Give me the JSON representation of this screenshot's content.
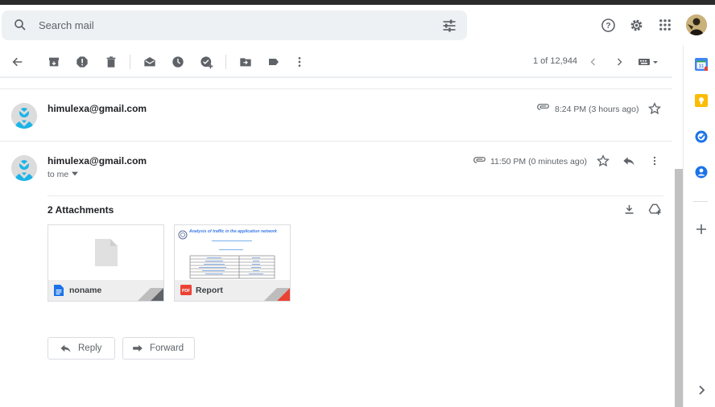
{
  "search": {
    "placeholder": "Search mail"
  },
  "toolbar": {
    "pager_text": "1 of 12,944"
  },
  "messages": [
    {
      "sender": "himulexa@gmail.com",
      "time": "8:24 PM (3 hours ago)"
    },
    {
      "sender": "himulexa@gmail.com",
      "time": "11:50 PM (0 minutes ago)",
      "recipient": "to me"
    }
  ],
  "attachments": {
    "title": "2 Attachments",
    "items": [
      {
        "name": "noname",
        "type_icon": "doc-icon",
        "accent": "#1a73e8"
      },
      {
        "name": "Report",
        "type_icon": "pdf-icon",
        "accent": "#ea4335",
        "type_label": "PDF",
        "preview_title": "Analysis of traffic in the application network"
      }
    ]
  },
  "actions": {
    "reply_label": "Reply",
    "forward_label": "Forward"
  },
  "colors": {
    "accent_blue": "#1a73e8",
    "avatar_blue": "#1cb4e8",
    "calendar_blue": "#4285f4",
    "keep_yellow": "#fbbc04"
  }
}
